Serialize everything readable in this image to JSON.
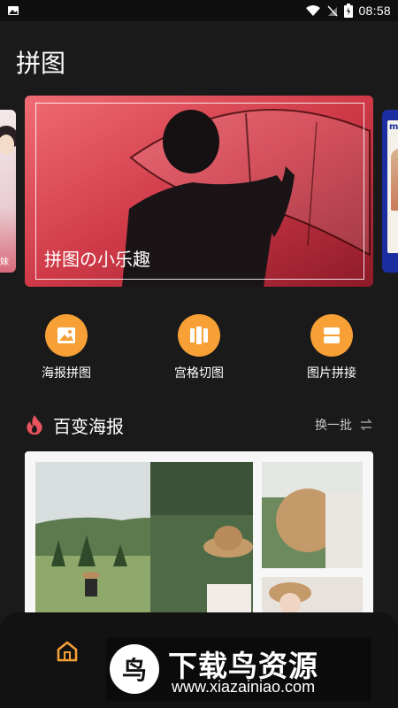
{
  "status_bar": {
    "time": "08:58",
    "icons": [
      "image-icon",
      "wifi-icon",
      "no-sim-icon",
      "battery-icon"
    ]
  },
  "header": {
    "title": "拼图"
  },
  "carousel": {
    "banner_title": "拼图の小乐趣",
    "left_peek_text": "妹",
    "right_peek_text": "m ta"
  },
  "features": [
    {
      "label": "海报拼图",
      "icon": "poster-image-icon"
    },
    {
      "label": "宫格切图",
      "icon": "grid-cut-icon"
    },
    {
      "label": "图片拼接",
      "icon": "image-join-icon"
    }
  ],
  "section": {
    "title": "百变海报",
    "icon": "fire-icon",
    "refresh_label": "换一批",
    "refresh_icon": "swap-icon"
  },
  "bottom_nav": {
    "home_icon": "home-icon"
  },
  "watermark": {
    "title": "下载鸟资源",
    "url": "www.xiazainiao.com"
  },
  "colors": {
    "accent": "#f7a035",
    "background": "#1a1a1a",
    "fire": "#e8535d"
  }
}
